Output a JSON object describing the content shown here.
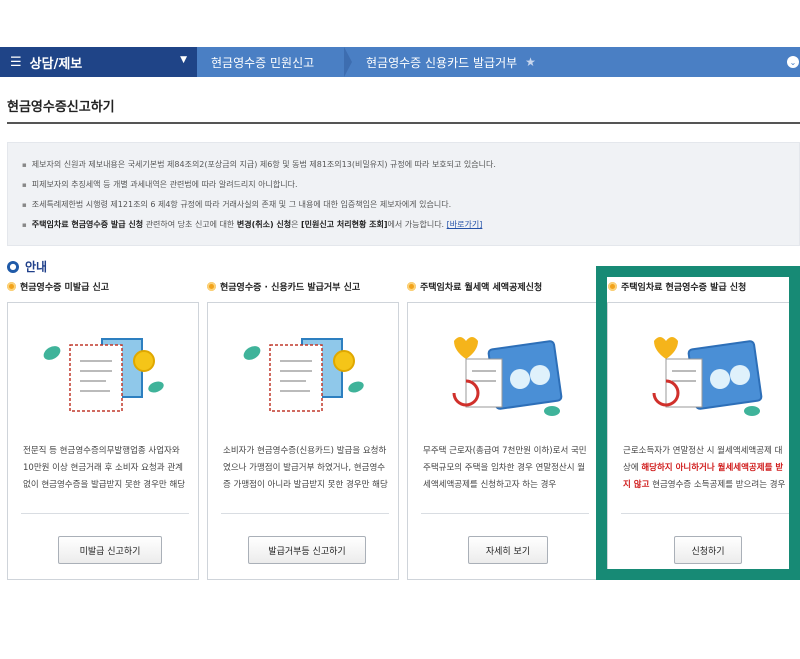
{
  "nav": {
    "main_label": "상담/제보",
    "crumb1": "현금영수증 민원신고",
    "crumb2": "현금영수증 신용카드 발급거부"
  },
  "page": {
    "title": "현금영수증신고하기"
  },
  "notice": {
    "line1": "제보자의 신원과 제보내용은 국세기본법 제84조의2(포상금의 지급) 제6항 및 동법 제81조의13(비밀유지) 규정에 따라 보호되고 있습니다.",
    "line2": "피제보자의 추징세액 등 개별 과세내역은 관련법에 따라 알려드리지 아니합니다.",
    "line3": "조세특례제한법 시행령 제121조의 6 제4항 규정에 따라 거래사실의 존재 및 그 내용에 대한 입증책임은 제보자에게 있습니다.",
    "line4_b1": "주택임차료 현금영수증 발급 신청",
    "line4_t1": " 관련하여 당초 신고에 대한 ",
    "line4_b2": "변경(취소) 신청",
    "line4_t2": "은 ",
    "line4_b3": "[민원신고 처리현황 조회]",
    "line4_t3": "에서 가능합니다. ",
    "line4_link": "[바로가기]"
  },
  "guide": {
    "label": "안내"
  },
  "cards": [
    {
      "head": "현금영수증 미발급 신고",
      "desc": "전문직 등 현금영수증의무발행업종 사업자와 10만원 이상 현금거래 후 소비자 요청과 관계 없이 현금영수증을 발급받지 못한 경우만 해당",
      "button": "미발급 신고하기"
    },
    {
      "head": "현금영수증 · 신용카드 발급거부 신고",
      "desc": "소비자가 현금영수증(신용카드) 발급을 요청하였으나 가맹점이 발급거부 하였거나, 현금영수증 가맹점이 아니라 발급받지 못한 경우만 해당",
      "button": "발급거부등 신고하기"
    },
    {
      "head": "주택임차료 월세액 세액공제신청",
      "desc": "무주택 근로자(총급여 7천만원 이하)로서 국민주택규모의 주택을 임차한 경우 연말정산시 월세액세액공제를 신청하고자 하는 경우",
      "button": "자세히 보기"
    },
    {
      "head": "주택임차료 현금영수증 발급 신청",
      "desc_pre": "근로소득자가 연말정산 시 월세액세액공제 대상에 ",
      "desc_red": "해당하지 아니하거나 월세세액공제를 받지 않고",
      "desc_post": " 현금영수증 소득공제를 받으려는 경우",
      "button": "신청하기"
    }
  ],
  "colors": {
    "nav_bg": "#4a7fc4",
    "nav_main_bg": "#1f4487",
    "highlight": "#178a75",
    "accent_red": "#d01c1c"
  }
}
